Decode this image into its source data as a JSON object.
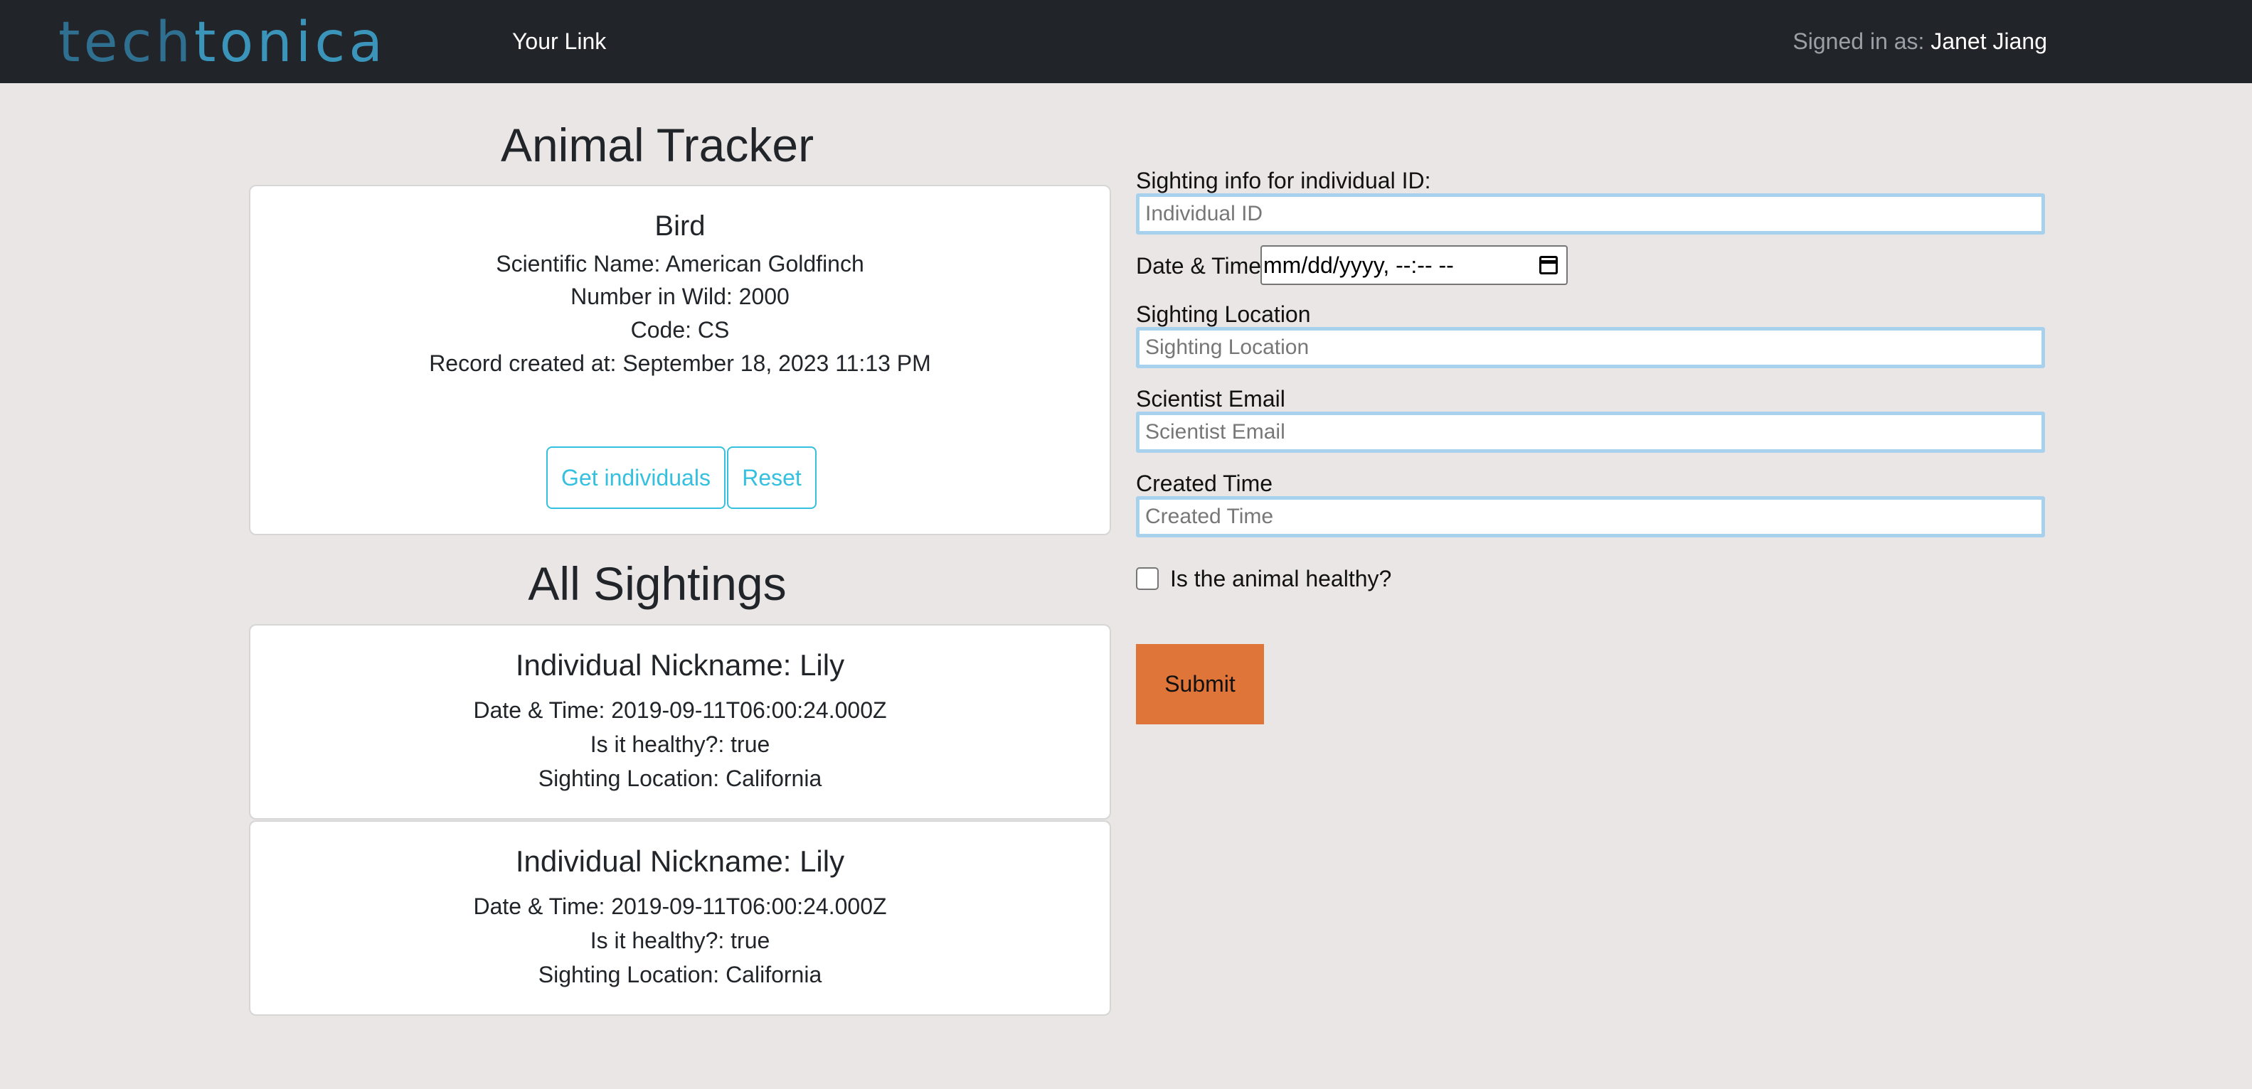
{
  "navbar": {
    "brand_part1": "tech",
    "brand_part2": "tonica",
    "link": "Your Link",
    "signed_in_label": "Signed in as:",
    "signed_in_user": "Janet Jiang"
  },
  "species": {
    "heading": "Animal Tracker",
    "name": "Bird",
    "scientific_name": "Scientific Name: American Goldfinch",
    "number_in_wild": "Number in Wild: 2000",
    "code": "Code: CS",
    "created_at": "Record created at: September 18, 2023 11:13 PM",
    "get_individuals_label": "Get individuals",
    "reset_label": "Reset"
  },
  "sightings": {
    "heading": "All Sightings",
    "items": [
      {
        "nickname": "Individual Nickname: Lily",
        "datetime": "Date & Time: 2019-09-11T06:00:24.000Z",
        "healthy": "Is it healthy?: true",
        "location": "Sighting Location: California"
      },
      {
        "nickname": "Individual Nickname: Lily",
        "datetime": "Date & Time: 2019-09-11T06:00:24.000Z",
        "healthy": "Is it healthy?: true",
        "location": "Sighting Location: California"
      }
    ]
  },
  "form": {
    "individual_label": "Sighting info for individual ID:",
    "individual_placeholder": "Individual ID",
    "datetime_label": "Date & Time",
    "datetime_value": "mm/dd/yyyy, --:-- --",
    "location_label": "Sighting Location",
    "location_placeholder": "Sighting Location",
    "email_label": "Scientist Email",
    "email_placeholder": "Scientist Email",
    "created_label": "Created Time",
    "created_placeholder": "Created Time",
    "healthy_label": "Is the animal healthy?",
    "submit_label": "Submit"
  },
  "colors": {
    "navbar": "#212529",
    "background": "#eae6e5",
    "outline_button": "#35c0e0",
    "submit": "#e07539"
  }
}
